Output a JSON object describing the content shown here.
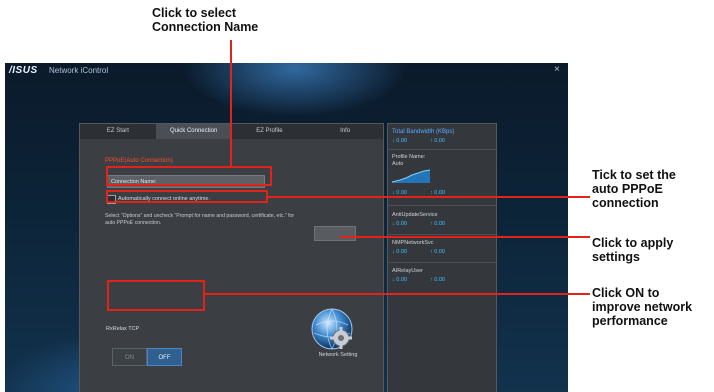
{
  "callouts": {
    "connection_name": "Click to select\nConnection Name",
    "auto_pppoe": "Tick to set the\nauto PPPoE\nconnection",
    "apply_settings": "Click to apply\nsettings",
    "on_network": "Click ON to\nimprove network\nperformance"
  },
  "app": {
    "brand": "/ISUS",
    "title": "Network iControl",
    "close": "×"
  },
  "tabs": [
    {
      "label": "EZ Start"
    },
    {
      "label": "Quick Connection",
      "active": true
    },
    {
      "label": "EZ Profile"
    },
    {
      "label": "Info"
    }
  ],
  "form": {
    "section_heading": "PPPoE(Auto Connection)",
    "connection_value": "Connection Name:",
    "auto_connect_label": "Automatically connect online anytime.",
    "auto_connect_checked": false,
    "info_text": "Select “Options” and uncheck “Prompt for name and password, certificate, etc.” for auto PPPoE connection.",
    "apply_label": "",
    "rx_label": "RxRelax TCP",
    "toggle_on": "ON",
    "toggle_off": "OFF",
    "toggle_selected": "OFF"
  },
  "network": {
    "label": "Network Setting"
  },
  "stats": {
    "total_title": "Total Bandwidth (KBps)",
    "total_values": [
      "↓ 0.00",
      "↑ 0.00"
    ],
    "profile_label": "Profile Name:",
    "profile_value": "Auto",
    "profile_values": [
      "↓ 0.00",
      "↑ 0.00"
    ],
    "service1": "AntiUpdateService",
    "service1_values": [
      "↓ 0.00",
      "↑ 0.00"
    ],
    "service2": "NMPNetworkSvc",
    "service2_values": [
      "↓ 0.00",
      "↑ 0.00"
    ],
    "service3": "AIRelayUser",
    "service3_values": [
      "↓ 0.00",
      "↑ 0.00"
    ]
  },
  "colors": {
    "accent_red": "#e2231a",
    "window_bg": "#0c2438",
    "highlight_blue": "#3cc3ff"
  }
}
